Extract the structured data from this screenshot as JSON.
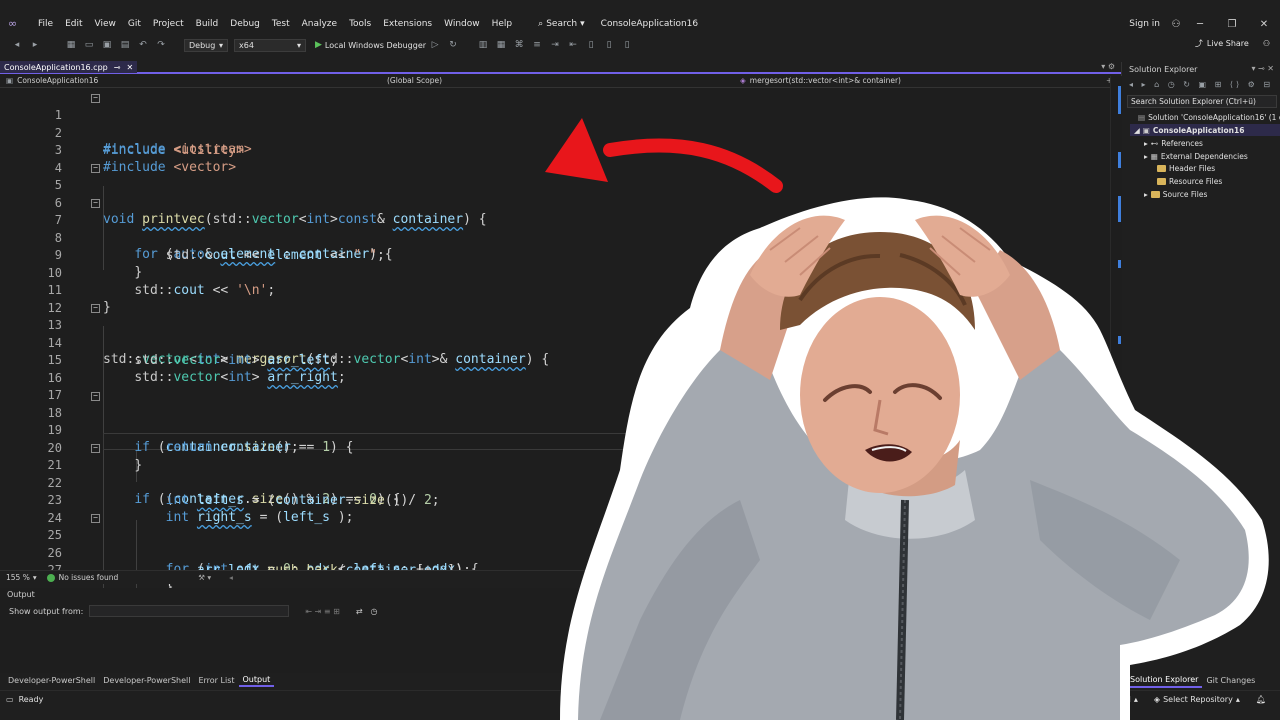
{
  "menu": {
    "items": [
      "File",
      "Edit",
      "View",
      "Git",
      "Project",
      "Build",
      "Debug",
      "Test",
      "Analyze",
      "Tools",
      "Extensions",
      "Window",
      "Help"
    ],
    "search_label": "Search",
    "solution_name": "ConsoleApplication16",
    "sign_in": "Sign in"
  },
  "toolbar": {
    "config": "Debug",
    "platform": "x64",
    "run_label": "Local Windows Debugger",
    "live_share": "Live Share"
  },
  "editor": {
    "tab_name": "ConsoleApplication16.cpp",
    "nav_project": "ConsoleApplication16",
    "nav_scope": "(Global Scope)",
    "nav_member": "mergesort(std::vector<int>& container)",
    "zoom": "155 %",
    "issues": "No issues found"
  },
  "code": {
    "line_numbers": [
      "1",
      "2",
      "3",
      "4",
      "5",
      "6",
      "7",
      "8",
      "9",
      "10",
      "11",
      "12",
      "13",
      "14",
      "15",
      "16",
      "17",
      "18",
      "19",
      "20",
      "21",
      "22",
      "23",
      "24",
      "25",
      "26",
      "27"
    ]
  },
  "output": {
    "title": "Output",
    "show_from": "Show output from:"
  },
  "bottom_tabs": [
    "Developer-PowerShell",
    "Developer-PowerShell",
    "Error List",
    "Output"
  ],
  "status": {
    "ready": "Ready",
    "control": "Control",
    "repo": "Select Repository"
  },
  "solution_explorer": {
    "title": "Solution Explorer",
    "search_placeholder": "Search Solution Explorer (Ctrl+ü)",
    "solution_label": "Solution 'ConsoleApplication16' (1 o",
    "project": "ConsoleApplication16",
    "nodes": [
      "References",
      "External Dependencies",
      "Header Files",
      "Resource Files",
      "Source Files"
    ],
    "tabs": [
      "Solution Explorer",
      "Git Changes"
    ]
  },
  "colors": {
    "accent": "#7160e8",
    "arrow": "#e8161b",
    "keyword": "#569cd6",
    "type": "#4ec9b0",
    "function": "#dcdcaa"
  }
}
